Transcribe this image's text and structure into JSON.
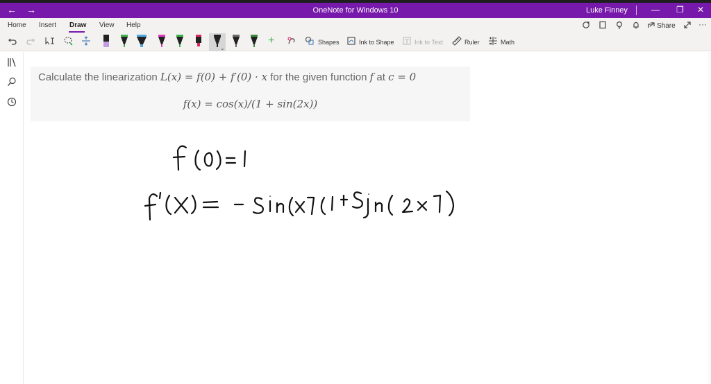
{
  "window": {
    "title": "OneNote for Windows 10",
    "user": "Luke Finney",
    "back_glyph": "←",
    "forward_glyph": "→",
    "minimize_glyph": "—",
    "restore_glyph": "❐",
    "close_glyph": "✕"
  },
  "menu": {
    "tabs": [
      "Home",
      "Insert",
      "Draw",
      "View",
      "Help"
    ],
    "active_tab": "Draw",
    "share_label": "Share",
    "more_glyph": "···"
  },
  "ribbon": {
    "shapes_label": "Shapes",
    "ink_to_shape_label": "Ink to Shape",
    "ink_to_text_label": "Ink to Text",
    "ruler_label": "Ruler",
    "math_label": "Math",
    "add_glyph": "+",
    "pens": [
      {
        "color": "#c39be0"
      },
      {
        "color": "#3cb44b"
      },
      {
        "color": "#4fa8e0"
      },
      {
        "color": "#e03cc0"
      },
      {
        "color": "#3cb44b"
      },
      {
        "color": "#e0246a"
      },
      {
        "color": "#222222"
      },
      {
        "color": "#6a6a6a"
      },
      {
        "color": "#3c8c3c"
      }
    ]
  },
  "question": {
    "prefix": "Calculate the linearization ",
    "formula": "L(x) = f(0) + f′(0) · x",
    "middle": " for the given function ",
    "func_symbol": "f",
    "at_text": " at ",
    "point": "c = 0",
    "equation": "f(x) = cos(x)/(1 + sin(2x))"
  },
  "colors": {
    "titlebar": "#7719aa",
    "ribbon_bg": "#f3f2f1",
    "card_bg": "#f6f6f7",
    "ink": "#111111"
  }
}
